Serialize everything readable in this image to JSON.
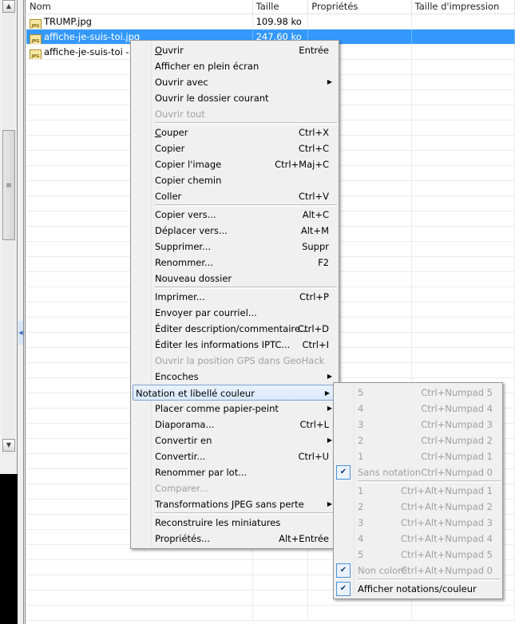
{
  "list": {
    "columns": [
      "Nom",
      "Taille",
      "Propriétés",
      "Taille d'impression"
    ],
    "rows": [
      {
        "name": "TRUMP.jpg",
        "size": "109.98 ko",
        "selected": false
      },
      {
        "name": "affiche-je-suis-toi.jpg",
        "size": "247.60 ko",
        "selected": true
      },
      {
        "name": "affiche-je-suis-toi - Copie.jpg",
        "size": "",
        "selected": false
      }
    ],
    "file_icon": "JPG"
  },
  "context_menu": {
    "groups": [
      [
        {
          "label": "Ouvrir",
          "u": "O",
          "rest": "uvrir",
          "shortcut": "Entrée"
        },
        {
          "label": "Afficher en plein écran",
          "shortcut": ""
        },
        {
          "label": "Ouvrir avec",
          "submenu": true
        },
        {
          "label": "Ouvrir le dossier courant"
        },
        {
          "label": "Ouvrir tout",
          "disabled": true
        }
      ],
      [
        {
          "label": "Couper",
          "u": "C",
          "rest": "ouper",
          "shortcut": "Ctrl+X"
        },
        {
          "label": "Copier",
          "shortcut": "Ctrl+C"
        },
        {
          "label": "Copier l'image",
          "shortcut": "Ctrl+Maj+C"
        },
        {
          "label": "Copier chemin"
        },
        {
          "label": "Coller",
          "shortcut": "Ctrl+V"
        }
      ],
      [
        {
          "label": "Copier vers...",
          "shortcut": "Alt+C"
        },
        {
          "label": "Déplacer vers...",
          "shortcut": "Alt+M"
        },
        {
          "label": "Supprimer...",
          "shortcut": "Suppr"
        },
        {
          "label": "Renommer...",
          "shortcut": "F2"
        },
        {
          "label": "Nouveau dossier"
        }
      ],
      [
        {
          "label": "Imprimer...",
          "shortcut": "Ctrl+P"
        },
        {
          "label": "Envoyer par courriel..."
        },
        {
          "label": "Éditer description/commentaire...",
          "shortcut": "Ctrl+D"
        },
        {
          "label": "Éditer les informations IPTC...",
          "shortcut": "Ctrl+I"
        },
        {
          "label": "Ouvrir la position GPS dans GeoHack",
          "disabled": true
        },
        {
          "label": "Encoches",
          "submenu": true
        },
        {
          "label": "Notation et libellé couleur",
          "submenu": true,
          "highlighted": true
        },
        {
          "label": "Placer comme papier-peint",
          "submenu": true
        },
        {
          "label": "Diaporama...",
          "shortcut": "Ctrl+L"
        },
        {
          "label": "Convertir en",
          "submenu": true
        },
        {
          "label": "Convertir...",
          "shortcut": "Ctrl+U"
        },
        {
          "label": "Renommer par lot..."
        },
        {
          "label": "Comparer...",
          "disabled": true
        },
        {
          "label": "Transformations JPEG sans perte",
          "submenu": true
        }
      ],
      [
        {
          "label": "Reconstruire les miniatures"
        },
        {
          "label": "Propriétés...",
          "shortcut": "Alt+Entrée"
        }
      ]
    ]
  },
  "submenu": {
    "groups": [
      [
        {
          "label": "5",
          "shortcut": "Ctrl+Numpad 5",
          "disabled": true
        },
        {
          "label": "4",
          "shortcut": "Ctrl+Numpad 4",
          "disabled": true
        },
        {
          "label": "3",
          "shortcut": "Ctrl+Numpad 3",
          "disabled": true
        },
        {
          "label": "2",
          "shortcut": "Ctrl+Numpad 2",
          "disabled": true
        },
        {
          "label": "1",
          "shortcut": "Ctrl+Numpad 1",
          "disabled": true
        },
        {
          "label": "Sans notation",
          "shortcut": "Ctrl+Numpad 0",
          "disabled": true,
          "checked": true
        }
      ],
      [
        {
          "label": "1",
          "shortcut": "Ctrl+Alt+Numpad 1",
          "disabled": true
        },
        {
          "label": "2",
          "shortcut": "Ctrl+Alt+Numpad 2",
          "disabled": true
        },
        {
          "label": "3",
          "shortcut": "Ctrl+Alt+Numpad 3",
          "disabled": true
        },
        {
          "label": "4",
          "shortcut": "Ctrl+Alt+Numpad 4",
          "disabled": true
        },
        {
          "label": "5",
          "shortcut": "Ctrl+Alt+Numpad 5",
          "disabled": true
        },
        {
          "label": "Non coloré",
          "shortcut": "Ctrl+Alt+Numpad 0",
          "disabled": true,
          "checked": true
        }
      ],
      [
        {
          "label": "Afficher notations/couleur",
          "checked": true
        }
      ]
    ]
  }
}
